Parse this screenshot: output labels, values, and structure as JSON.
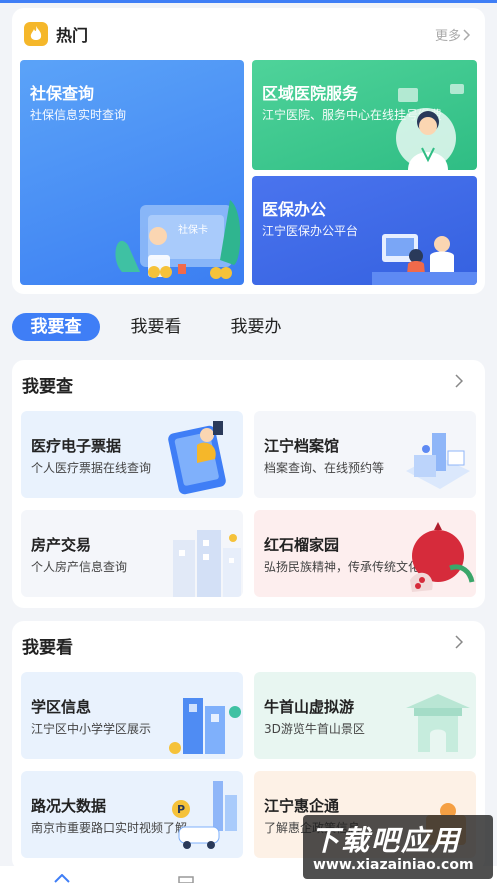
{
  "hot": {
    "title": "热门",
    "more": "更多",
    "tiles": [
      {
        "title": "社保查询",
        "subtitle": "社保信息实时查询",
        "card_text": "社保卡"
      },
      {
        "title": "区域医院服务",
        "subtitle": "江宁医院、服务中心在线挂号缴费"
      },
      {
        "title": "医保办公",
        "subtitle": "江宁医保办公平台"
      }
    ]
  },
  "tabs": [
    "我要查",
    "我要看",
    "我要办"
  ],
  "sections": [
    {
      "title": "我要查",
      "items": [
        {
          "title": "医疗电子票据",
          "subtitle": "个人医疗票据在线查询"
        },
        {
          "title": "江宁档案馆",
          "subtitle": "档案查询、在线预约等"
        },
        {
          "title": "房产交易",
          "subtitle": "个人房产信息查询"
        },
        {
          "title": "红石榴家园",
          "subtitle": "弘扬民族精神，传承传统文化"
        }
      ]
    },
    {
      "title": "我要看",
      "items": [
        {
          "title": "学区信息",
          "subtitle": "江宁区中小学学区展示"
        },
        {
          "title": "牛首山虚拟游",
          "subtitle": "3D游览牛首山景区"
        },
        {
          "title": "路况大数据",
          "subtitle": "南京市重要路口实时视频了解"
        },
        {
          "title": "江宁惠企通",
          "subtitle": "了解惠企政策信息"
        }
      ]
    }
  ],
  "watermark": {
    "line1": "下载吧应用",
    "line2": "www.xiazainiao.com"
  },
  "colors": {
    "accent": "#3f7ef6",
    "hot_icon": "#f5b72a"
  }
}
